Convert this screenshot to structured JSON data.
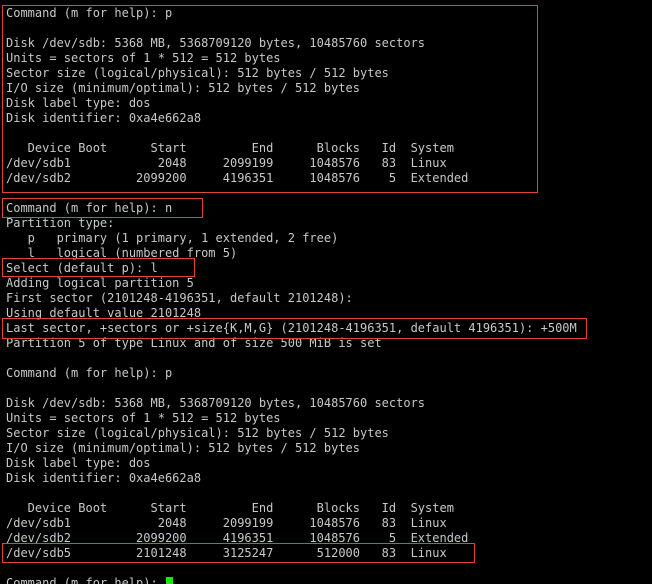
{
  "colors": {
    "background": "#000000",
    "text": "#c8c8c8",
    "highlight_border": "#e0453a",
    "cursor": "#19e619"
  },
  "lines": [
    "Command (m for help): p",
    "",
    "Disk /dev/sdb: 5368 MB, 5368709120 bytes, 10485760 sectors",
    "Units = sectors of 1 * 512 = 512 bytes",
    "Sector size (logical/physical): 512 bytes / 512 bytes",
    "I/O size (minimum/optimal): 512 bytes / 512 bytes",
    "Disk label type: dos",
    "Disk identifier: 0xa4e662a8",
    "",
    "   Device Boot      Start         End      Blocks   Id  System",
    "/dev/sdb1            2048     2099199     1048576   83  Linux",
    "/dev/sdb2         2099200     4196351     1048576    5  Extended",
    "",
    "Command (m for help): n",
    "Partition type:",
    "   p   primary (1 primary, 1 extended, 2 free)",
    "   l   logical (numbered from 5)",
    "Select (default p): l",
    "Adding logical partition 5",
    "First sector (2101248-4196351, default 2101248):",
    "Using default value 2101248",
    "Last sector, +sectors or +size{K,M,G} (2101248-4196351, default 4196351): +500M",
    "Partition 5 of type Linux and of size 500 MiB is set",
    "",
    "Command (m for help): p",
    "",
    "Disk /dev/sdb: 5368 MB, 5368709120 bytes, 10485760 sectors",
    "Units = sectors of 1 * 512 = 512 bytes",
    "Sector size (logical/physical): 512 bytes / 512 bytes",
    "I/O size (minimum/optimal): 512 bytes / 512 bytes",
    "Disk label type: dos",
    "Disk identifier: 0xa4e662a8",
    "",
    "   Device Boot      Start         End      Blocks   Id  System",
    "/dev/sdb1            2048     2099199     1048576   83  Linux",
    "/dev/sdb2         2099200     4196351     1048576    5  Extended",
    "/dev/sdb5         2101248     3125247      512000   83  Linux",
    "",
    "Command (m for help): "
  ]
}
